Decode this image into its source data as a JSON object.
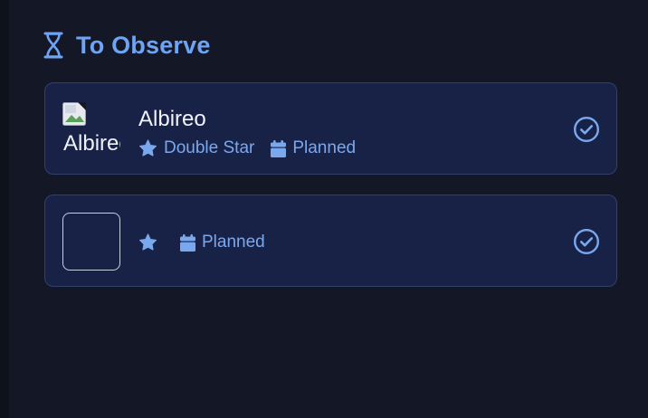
{
  "section": {
    "title": "To Observe",
    "icon": "hourglass-icon"
  },
  "colors": {
    "background": "#141826",
    "card": "#182247",
    "card_border": "#31416c",
    "accent": "#6ea4f5",
    "text": "#f1f3fa"
  },
  "cards": [
    {
      "name": "Albireo",
      "image_alt": "Albireo",
      "type": "Double Star",
      "type_icon": "star-icon",
      "status": "Planned",
      "status_icon": "calendar-icon",
      "action_icon": "check-circle-icon"
    },
    {
      "name": "",
      "image_alt": "",
      "type": "",
      "type_icon": "star-icon",
      "status": "Planned",
      "status_icon": "calendar-icon",
      "action_icon": "check-circle-icon"
    }
  ]
}
